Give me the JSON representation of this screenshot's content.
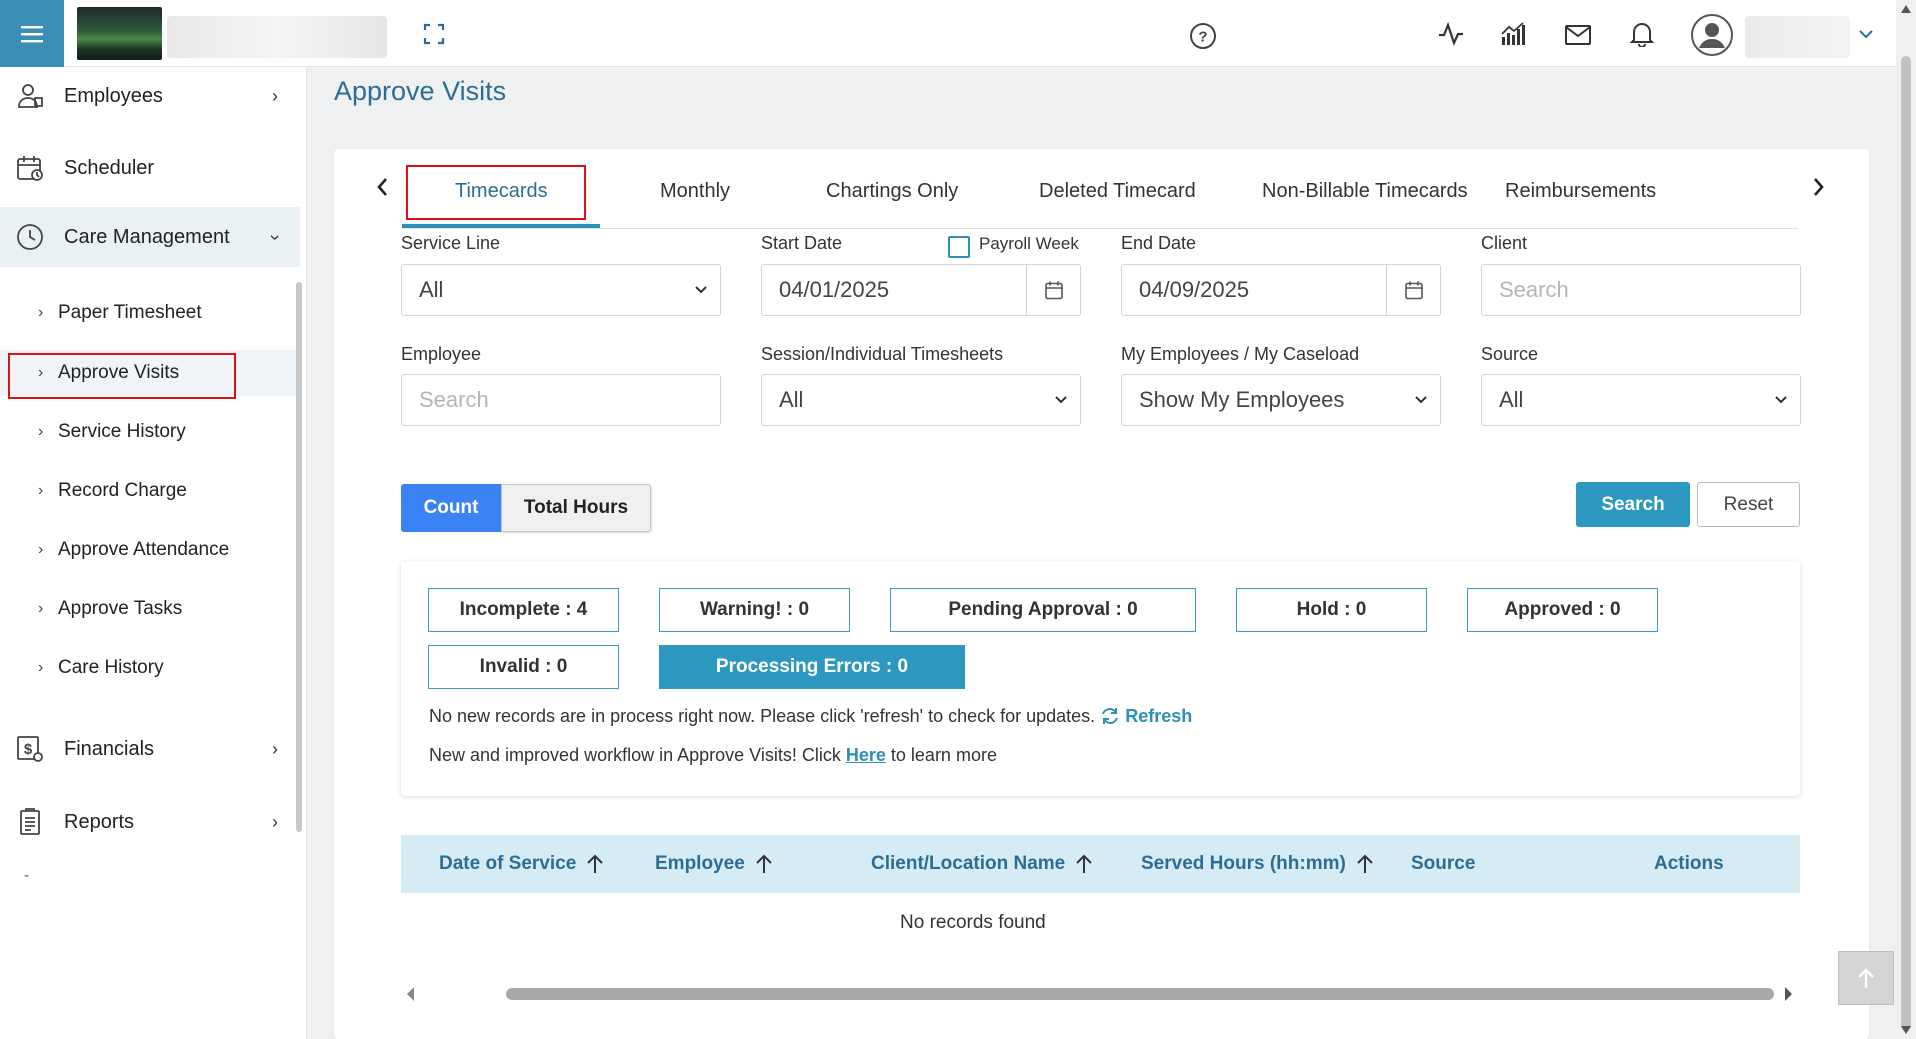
{
  "topbar": {
    "icons": [
      "menu-icon",
      "fullscreen-icon",
      "help-icon",
      "activity-icon",
      "analytics-icon",
      "mail-icon",
      "bell-icon",
      "user-avatar-icon",
      "chevron-down-icon"
    ]
  },
  "sidebar": {
    "items": [
      {
        "label": "Employees",
        "icon": "employees-icon"
      },
      {
        "label": "Scheduler",
        "icon": "calendar-icon"
      },
      {
        "label": "Care Management",
        "icon": "clock-icon"
      },
      {
        "label": "Financials",
        "icon": "dollar-icon"
      },
      {
        "label": "Reports",
        "icon": "report-icon"
      }
    ],
    "sub_items": [
      {
        "label": "Paper Timesheet"
      },
      {
        "label": "Approve Visits"
      },
      {
        "label": "Service History"
      },
      {
        "label": "Record Charge"
      },
      {
        "label": "Approve Attendance"
      },
      {
        "label": "Approve Tasks"
      },
      {
        "label": "Care History"
      }
    ],
    "trailing": "-"
  },
  "page": {
    "title": "Approve Visits"
  },
  "tabs": [
    {
      "label": "Timecards",
      "active": true
    },
    {
      "label": "Monthly"
    },
    {
      "label": "Chartings Only"
    },
    {
      "label": "Deleted Timecard"
    },
    {
      "label": "Non-Billable Timecards"
    },
    {
      "label": "Reimbursements"
    }
  ],
  "filters": {
    "service_line": {
      "label": "Service Line",
      "value": "All"
    },
    "start_date": {
      "label": "Start Date",
      "value": "04/01/2025"
    },
    "payroll_week": {
      "label": "Payroll Week",
      "checked": false
    },
    "end_date": {
      "label": "End Date",
      "value": "04/09/2025"
    },
    "client": {
      "label": "Client",
      "placeholder": "Search"
    },
    "employee": {
      "label": "Employee",
      "placeholder": "Search"
    },
    "session": {
      "label": "Session/Individual Timesheets",
      "value": "All"
    },
    "caseload": {
      "label": "My Employees / My Caseload",
      "value": "Show My Employees"
    },
    "source": {
      "label": "Source",
      "value": "All"
    }
  },
  "toggle": {
    "count": "Count",
    "total_hours": "Total Hours",
    "selected": "Count"
  },
  "actions": {
    "search": "Search",
    "reset": "Reset"
  },
  "stats": {
    "incomplete": "Incomplete : 4",
    "warning": "Warning! : 0",
    "pending": "Pending Approval : 0",
    "hold": "Hold : 0",
    "approved": "Approved : 0",
    "invalid": "Invalid : 0",
    "processing": "Processing Errors : 0"
  },
  "messages": {
    "refresh_msg": "No new records are in process right now. Please click 'refresh' to check for updates.",
    "refresh_link": "Refresh",
    "workflow_pre": "New and improved workflow in Approve Visits! Click",
    "workflow_link": "Here",
    "workflow_post": "to learn more"
  },
  "table": {
    "columns": [
      "Date of Service",
      "Employee",
      "Client/Location Name",
      "Served Hours (hh:mm)",
      "Source",
      "Actions"
    ],
    "empty": "No records found"
  },
  "colors": {
    "accent": "#2c98bf",
    "title": "#2c6e93",
    "count_active": "#3b82f6",
    "highlight": "#dd1111"
  }
}
